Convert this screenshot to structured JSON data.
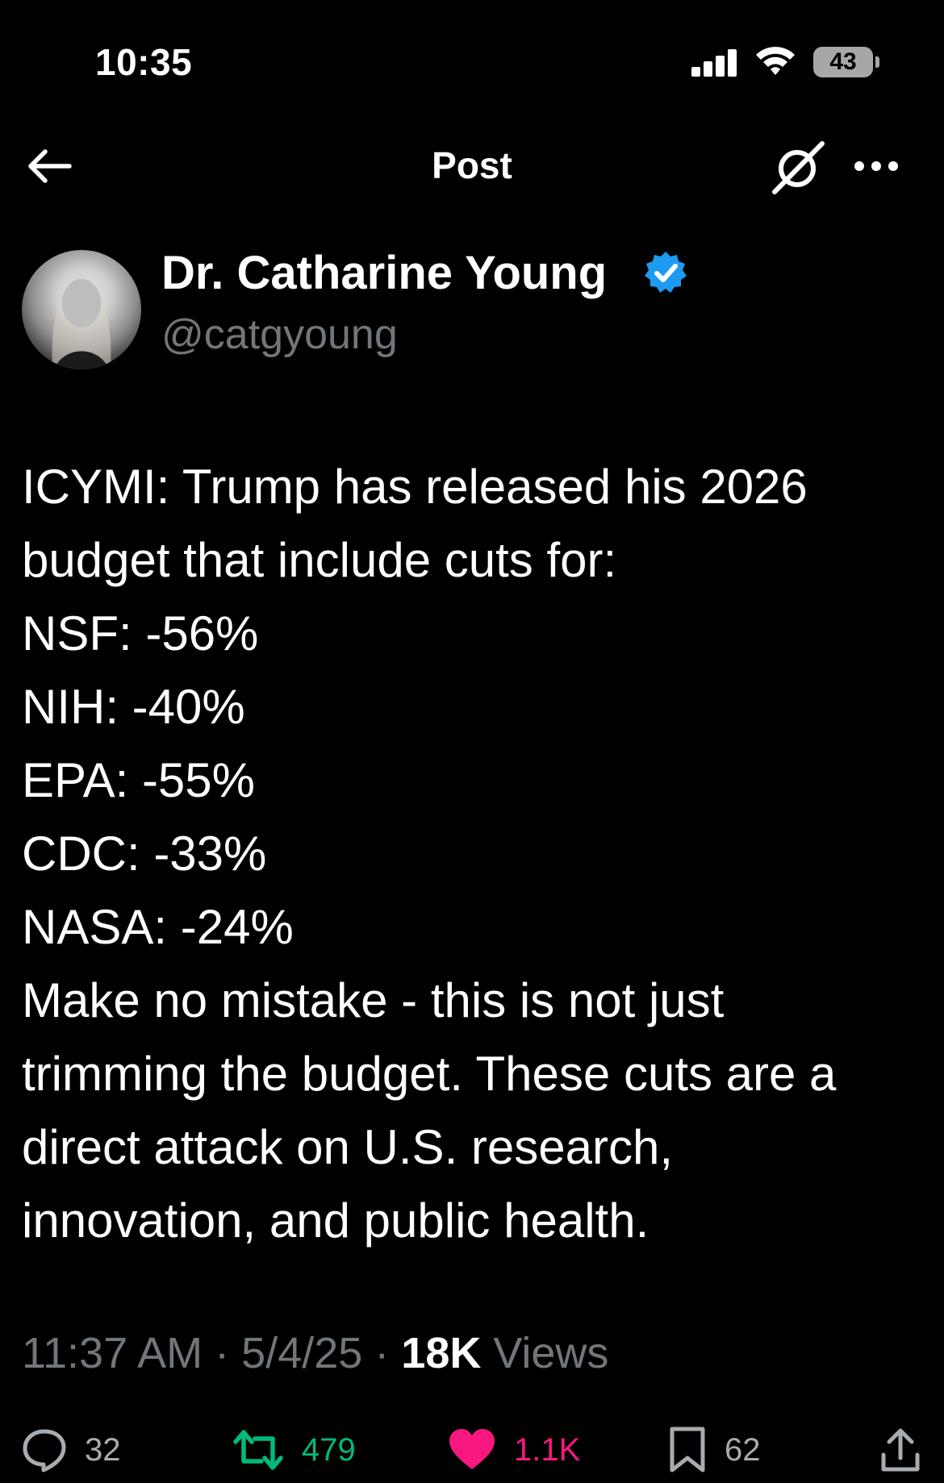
{
  "status_bar": {
    "time": "10:35",
    "battery": "43"
  },
  "header": {
    "title": "Post"
  },
  "author": {
    "display_name": "Dr. Catharine Young",
    "handle": "@catgyoung"
  },
  "post": {
    "text": "ICYMI: Trump has released his 2026\nbudget that include cuts for:\nNSF: -56%\nNIH: -40%\nEPA: -55%\nCDC: -33%\nNASA: -24%\nMake no mistake - this is not just\ntrimming the budget. These cuts are a\ndirect attack on U.S. research,\ninnovation, and public health."
  },
  "meta": {
    "time": "11:37 AM",
    "date": "5/4/25",
    "separator": " · ",
    "views_count": "18K",
    "views_label": " Views"
  },
  "actions": {
    "replies": "32",
    "reposts": "479",
    "likes": "1.1K",
    "bookmarks": "62"
  },
  "colors": {
    "background": "#000000",
    "text": "#ffffff",
    "secondary_text": "#71767b",
    "verified_badge": "#1d9bf0",
    "repost_active": "#00ba7c",
    "like_active": "#f91880"
  },
  "icons": {
    "back": "arrow-left-icon",
    "grok": "grok-icon",
    "more": "ellipsis-icon",
    "verified": "verified-badge-icon",
    "reply": "speech-bubble-icon",
    "repost": "repost-arrows-icon",
    "like": "heart-icon",
    "bookmark": "bookmark-icon",
    "share": "share-upload-icon"
  }
}
